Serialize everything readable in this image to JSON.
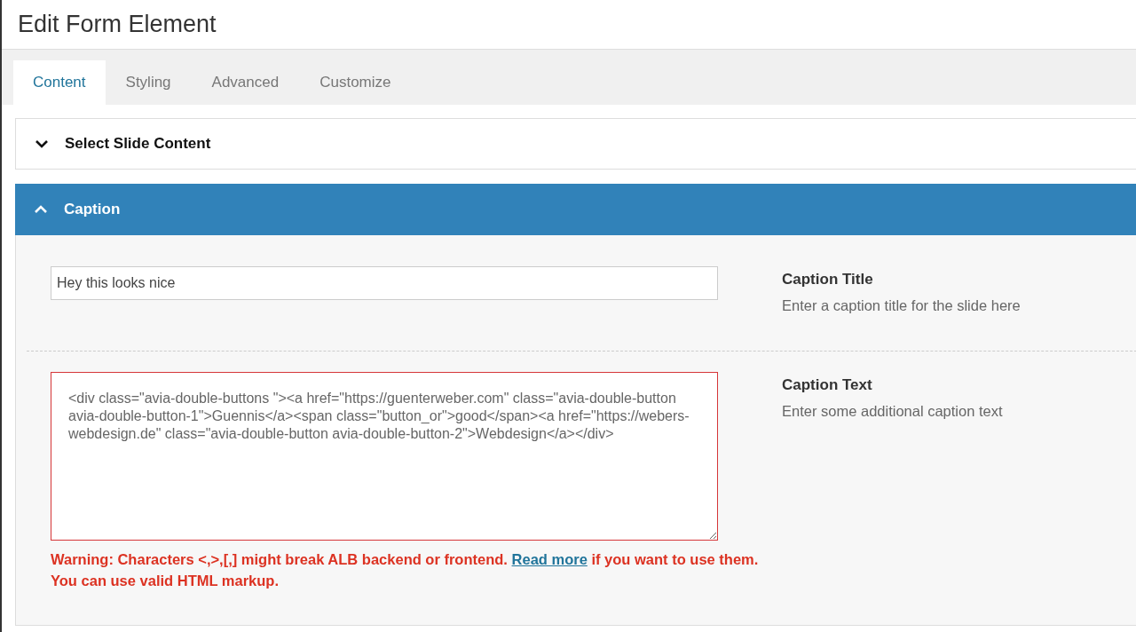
{
  "window": {
    "title": "Edit Form Element"
  },
  "tabs": [
    {
      "label": "Content",
      "selected": true
    },
    {
      "label": "Styling",
      "selected": false
    },
    {
      "label": "Advanced",
      "selected": false
    },
    {
      "label": "Customize",
      "selected": false
    }
  ],
  "sections": [
    {
      "title": "Select Slide Content",
      "expanded": false
    },
    {
      "title": "Caption",
      "expanded": true,
      "fields": [
        {
          "kind": "input",
          "value": "Hey this looks nice",
          "label": "Caption Title",
          "description": "Enter a caption title for the slide here"
        },
        {
          "kind": "textarea",
          "value": "<div class=\"avia-double-buttons \"><a href=\"https://guenterweber.com\" class=\"avia-double-button avia-double-button-1\">Guennis</a><span class=\"button_or\">good</span><a href=\"https://webers-webdesign.de\" class=\"avia-double-button avia-double-button-2\">Webdesign</a></div>",
          "label": "Caption Text",
          "description": "Enter some additional caption text",
          "invalid": true,
          "warning": {
            "before": "Warning: Characters <,>,[,] might break ALB backend or frontend.",
            "link": "Read more",
            "after": "if you want to use them. You can use valid HTML markup."
          }
        }
      ]
    }
  ]
}
